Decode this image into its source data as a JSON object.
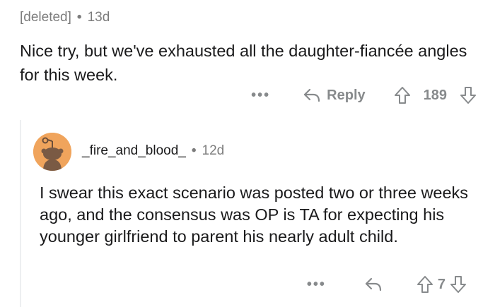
{
  "comment1": {
    "author": "[deleted]",
    "time": "13d",
    "body": "Nice try, but we've exhausted all the daughter-fiancée angles for this week.",
    "reply_label": "Reply",
    "score": "189",
    "more_label": "•••"
  },
  "comment2": {
    "author": "_fire_and_blood_",
    "time": "12d",
    "body": "I swear this exact scenario was posted two or three weeks ago, and the consensus was OP is TA for expecting his younger girlfriend to parent his nearly adult child.",
    "score": "7",
    "more_label": "•••",
    "avatar_color": "#f0a45c"
  },
  "meta_separator": "•",
  "colors": {
    "text": "#1a1a1b",
    "muted": "#7c7c7c",
    "icon": "#878a8c",
    "thread_line": "#edeff1"
  },
  "icons": [
    "reply-arrow-icon",
    "upvote-arrow-icon",
    "downvote-arrow-icon",
    "more-options-icon",
    "snoo-avatar-icon"
  ]
}
